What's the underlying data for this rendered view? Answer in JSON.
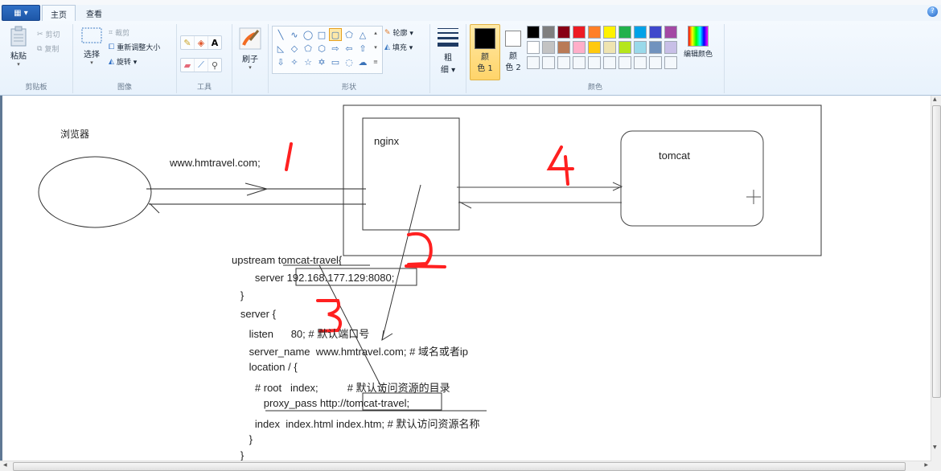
{
  "app": {
    "file_menu": "▦ ▾",
    "help_icon": "?"
  },
  "tabs": [
    {
      "label": "主页"
    },
    {
      "label": "查看"
    }
  ],
  "ribbon": {
    "clipboard": {
      "group_label": "剪贴板",
      "paste": "粘贴",
      "cut": "剪切",
      "copy": "复制"
    },
    "image": {
      "group_label": "图像",
      "select": "选择",
      "crop": "裁剪",
      "resize": "重新调整大小",
      "rotate": "旋转 ▾"
    },
    "tools": {
      "group_label": "工具"
    },
    "brushes": {
      "label": "刷子"
    },
    "shapes": {
      "group_label": "形状",
      "outline": "轮廓 ▾",
      "fill": "填充 ▾"
    },
    "size": {
      "label_line1": "粗",
      "label_line2": "细 ▾"
    },
    "colors": {
      "group_label": "颜色",
      "color1_line1": "颜",
      "color1_line2": "色 1",
      "color2_line1": "颜",
      "color2_line2": "色 2",
      "edit_colors": "编辑颜色",
      "color1_value": "#000000",
      "color2_value": "#ffffff",
      "palette": [
        "#000000",
        "#7f7f7f",
        "#880015",
        "#ed1c24",
        "#ff7f27",
        "#fff200",
        "#22b14c",
        "#00a2e8",
        "#3f48cc",
        "#a349a4",
        "#ffffff",
        "#c3c3c3",
        "#b97a57",
        "#ffaec9",
        "#ffc90e",
        "#efe4b0",
        "#b5e61d",
        "#99d9ea",
        "#7092be",
        "#c8bfe7",
        "#f4f8fc",
        "#f4f8fc",
        "#f4f8fc",
        "#f4f8fc",
        "#f4f8fc",
        "#f4f8fc",
        "#f4f8fc",
        "#f4f8fc",
        "#f4f8fc",
        "#f4f8fc"
      ]
    }
  },
  "drawing": {
    "browser_label": "浏览器",
    "request_url": "www.hmtravel.com;",
    "nginx_label": "nginx",
    "tomcat_label": "tomcat",
    "step_numbers": [
      "1",
      "2",
      "3",
      "4"
    ],
    "annotation_color": "#ff2020",
    "config_lines": [
      "upstream tomcat-travel{",
      "        server 192.168.177.129:8080;",
      "   }",
      "   server {",
      "      listen      80; # 默认端口号",
      "      server_name  www.hmtravel.com; # 域名或者ip",
      "      location / {",
      "        # root   index;          # 默认访问资源的目录",
      "           proxy_pass http://tomcat-travel;",
      "        index  index.html index.htm; # 默认访问资源名称",
      "      }",
      "   }"
    ]
  }
}
